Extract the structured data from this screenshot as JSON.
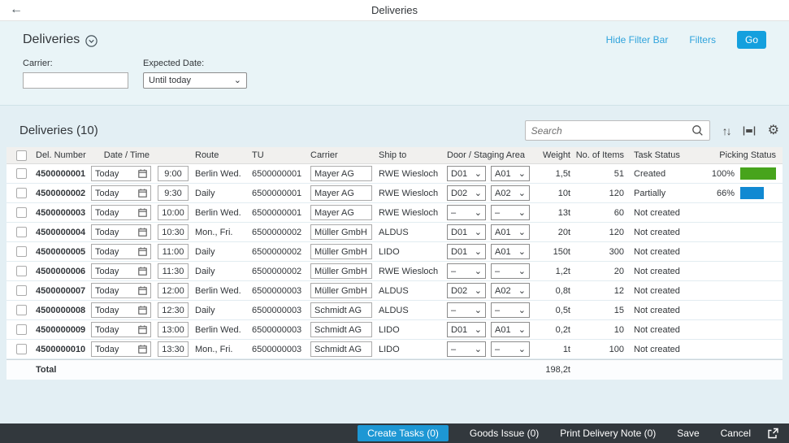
{
  "app": {
    "title": "Deliveries"
  },
  "filter_bar": {
    "title": "Deliveries",
    "hide_filter_bar_label": "Hide Filter Bar",
    "filters_label": "Filters",
    "go_label": "Go",
    "carrier_label": "Carrier:",
    "carrier_value": "",
    "expected_date_label": "Expected Date:",
    "expected_date_value": "Until today"
  },
  "table": {
    "title": "Deliveries (10)",
    "search_placeholder": "Search",
    "columns": [
      "Del. Number",
      "Date / Time",
      "Route",
      "TU",
      "Carrier",
      "Ship to",
      "Door / Staging Area",
      "Weight",
      "No. of Items",
      "Task Status",
      "Picking Status"
    ],
    "rows": [
      {
        "del_number": "4500000001",
        "date": "Today",
        "time": "9:00",
        "route": "Berlin Wed.",
        "tu": "6500000001",
        "carrier": "Mayer AG",
        "ship_to": "RWE Wiesloch",
        "door": "D01",
        "staging": "A01",
        "weight": "1,5t",
        "items": "51",
        "task_status": "Created",
        "picking_pct": "100%",
        "picking": 100,
        "picking_color": "green"
      },
      {
        "del_number": "4500000002",
        "date": "Today",
        "time": "9:30",
        "route": "Daily",
        "tu": "6500000001",
        "carrier": "Mayer AG",
        "ship_to": "RWE Wiesloch",
        "door": "D02",
        "staging": "A02",
        "weight": "10t",
        "items": "120",
        "task_status": "Partially",
        "picking_pct": "66%",
        "picking": 66,
        "picking_color": "blue"
      },
      {
        "del_number": "4500000003",
        "date": "Today",
        "time": "10:00",
        "route": "Berlin Wed.",
        "tu": "6500000001",
        "carrier": "Mayer AG",
        "ship_to": "RWE Wiesloch",
        "door": "–",
        "staging": "–",
        "weight": "13t",
        "items": "60",
        "task_status": "Not created",
        "picking_pct": "",
        "picking": null,
        "picking_color": null
      },
      {
        "del_number": "4500000004",
        "date": "Today",
        "time": "10:30",
        "route": "Mon., Fri.",
        "tu": "6500000002",
        "carrier": "Müller GmbH",
        "ship_to": "ALDUS",
        "door": "D01",
        "staging": "A01",
        "weight": "20t",
        "items": "120",
        "task_status": "Not created",
        "picking_pct": "",
        "picking": null,
        "picking_color": null
      },
      {
        "del_number": "4500000005",
        "date": "Today",
        "time": "11:00",
        "route": "Daily",
        "tu": "6500000002",
        "carrier": "Müller GmbH",
        "ship_to": "LIDO",
        "door": "D01",
        "staging": "A01",
        "weight": "150t",
        "items": "300",
        "task_status": "Not created",
        "picking_pct": "",
        "picking": null,
        "picking_color": null
      },
      {
        "del_number": "4500000006",
        "date": "Today",
        "time": "11:30",
        "route": "Daily",
        "tu": "6500000002",
        "carrier": "Müller GmbH",
        "ship_to": "RWE Wiesloch",
        "door": "–",
        "staging": "–",
        "weight": "1,2t",
        "items": "20",
        "task_status": "Not created",
        "picking_pct": "",
        "picking": null,
        "picking_color": null
      },
      {
        "del_number": "4500000007",
        "date": "Today",
        "time": "12:00",
        "route": "Berlin Wed.",
        "tu": "6500000003",
        "carrier": "Müller GmbH",
        "ship_to": "ALDUS",
        "door": "D02",
        "staging": "A02",
        "weight": "0,8t",
        "items": "12",
        "task_status": "Not created",
        "picking_pct": "",
        "picking": null,
        "picking_color": null
      },
      {
        "del_number": "4500000008",
        "date": "Today",
        "time": "12:30",
        "route": "Daily",
        "tu": "6500000003",
        "carrier": "Schmidt AG",
        "ship_to": "ALDUS",
        "door": "–",
        "staging": "–",
        "weight": "0,5t",
        "items": "15",
        "task_status": "Not created",
        "picking_pct": "",
        "picking": null,
        "picking_color": null
      },
      {
        "del_number": "4500000009",
        "date": "Today",
        "time": "13:00",
        "route": "Berlin Wed.",
        "tu": "6500000003",
        "carrier": "Schmidt AG",
        "ship_to": "LIDO",
        "door": "D01",
        "staging": "A01",
        "weight": "0,2t",
        "items": "10",
        "task_status": "Not created",
        "picking_pct": "",
        "picking": null,
        "picking_color": null
      },
      {
        "del_number": "4500000010",
        "date": "Today",
        "time": "13:30",
        "route": "Mon., Fri.",
        "tu": "6500000003",
        "carrier": "Schmidt AG",
        "ship_to": "LIDO",
        "door": "–",
        "staging": "–",
        "weight": "1t",
        "items": "100",
        "task_status": "Not created",
        "picking_pct": "",
        "picking": null,
        "picking_color": null
      }
    ],
    "total_label": "Total",
    "total_weight": "198,2t"
  },
  "footer": {
    "create_tasks_label": "Create Tasks (0)",
    "goods_issue_label": "Goods Issue (0)",
    "print_delivery_note_label": "Print Delivery Note (0)",
    "save_label": "Save",
    "cancel_label": "Cancel"
  },
  "icons": {
    "back": "←",
    "sort": "↑↓",
    "settings": "⚙",
    "chevron_down": "⌄"
  },
  "colors": {
    "accent_blue": "#14a0de",
    "link_blue": "#2fa3dc",
    "bar_green": "#47a41c",
    "bar_blue": "#1189d2",
    "footer_bg": "#32383d",
    "footer_button_blue": "#1d97d4"
  }
}
